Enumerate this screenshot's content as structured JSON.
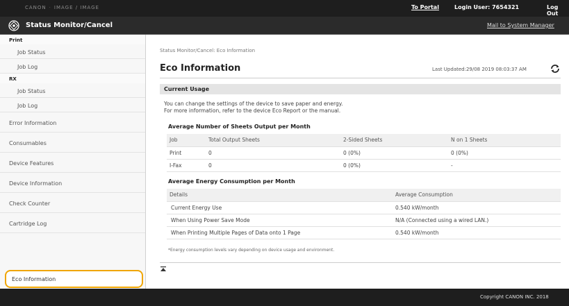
{
  "topbar": {
    "device_name": "CANON",
    "device_name_2": "IMAGE / IMAGE",
    "portal": "To Portal",
    "login_user": "Login User:  7654321",
    "logout": "Log Out"
  },
  "header": {
    "title": "Status Monitor/Cancel",
    "mail_link": "Mail to System Manager"
  },
  "sidebar": {
    "print_section": "Print",
    "print_items": [
      "Job Status",
      "Job Log"
    ],
    "rx_section": "RX",
    "rx_items": [
      "Job Status",
      "Job Log"
    ],
    "main_items": [
      "Error Information",
      "Consumables",
      "Device Features",
      "Device Information",
      "Check Counter",
      "Cartridge Log"
    ],
    "active_item": "Eco Information"
  },
  "main": {
    "breadcrumb": "Status Monitor/Cancel: Eco Information",
    "title": "Eco Information",
    "last_updated": "Last Updated:29/08 2019 08:03:37 AM",
    "section_title": "Current Usage",
    "desc_line1": "You can change the settings of the device to save paper and energy.",
    "desc_line2": "For more information, refer to the device Eco Report or the manual.",
    "sheets": {
      "title": "Average Number of Sheets Output per Month",
      "headers": [
        "Job",
        "Total Output Sheets",
        "2-Sided Sheets",
        "N on 1 Sheets"
      ],
      "rows": [
        [
          "Print",
          "0",
          "0 (0%)",
          "0 (0%)"
        ],
        [
          "I-Fax",
          "0",
          "0 (0%)",
          "-"
        ]
      ]
    },
    "energy": {
      "title": "Average Energy Consumption per Month",
      "headers": [
        "Details",
        "Average Consumption"
      ],
      "rows": [
        [
          "Current Energy Use",
          "0.540 kW/month"
        ],
        [
          "When Using Power Save Mode",
          "N/A (Connected using a wired LAN.)"
        ],
        [
          "When Printing Multiple Pages of Data onto 1 Page",
          "0.540 kW/month"
        ]
      ]
    },
    "footnote": "*Energy consumption levels vary depending on device usage and environment."
  },
  "footer": {
    "copyright": "Copyright CANON INC. 2018"
  },
  "colors": {
    "highlight": "#f0a500",
    "topbar": "#1e1e1e"
  }
}
